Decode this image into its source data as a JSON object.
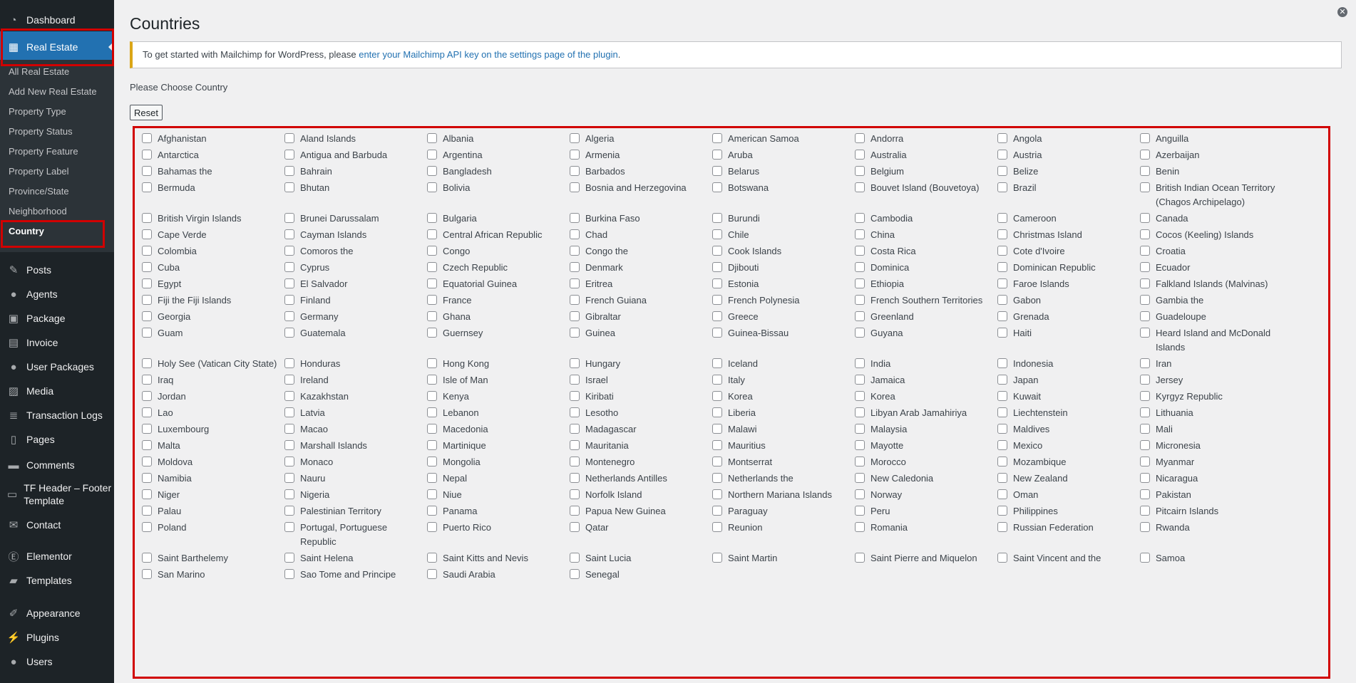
{
  "sidebar": {
    "top_items": [
      {
        "label": "Dashboard",
        "icon": "dashboard-icon"
      },
      {
        "label": "Real Estate",
        "icon": "building-icon"
      }
    ],
    "submenu": [
      "All Real Estate",
      "Add New Real Estate",
      "Property Type",
      "Property Status",
      "Property Feature",
      "Property Label",
      "Province/State",
      "Neighborhood",
      "Country"
    ],
    "bottom_items": [
      {
        "label": "Posts",
        "icon": "pin-icon"
      },
      {
        "label": "Agents",
        "icon": "user-icon"
      },
      {
        "label": "Package",
        "icon": "package-icon"
      },
      {
        "label": "Invoice",
        "icon": "invoice-icon"
      },
      {
        "label": "User Packages",
        "icon": "users-icon"
      },
      {
        "label": "Media",
        "icon": "media-icon"
      },
      {
        "label": "Transaction Logs",
        "icon": "list-icon"
      },
      {
        "label": "Pages",
        "icon": "pages-icon"
      },
      {
        "label": "Comments",
        "icon": "comments-icon"
      },
      {
        "label": "TF Header – Footer Template",
        "icon": "template-icon"
      },
      {
        "label": "Contact",
        "icon": "mail-icon"
      },
      {
        "label": "Elementor",
        "icon": "elementor-icon"
      },
      {
        "label": "Templates",
        "icon": "folder-icon"
      },
      {
        "label": "Appearance",
        "icon": "brush-icon"
      },
      {
        "label": "Plugins",
        "icon": "plugin-icon"
      },
      {
        "label": "Users",
        "icon": "user-icon"
      }
    ]
  },
  "page": {
    "title": "Countries",
    "notice_text": "To get started with Mailchimp for WordPress, please ",
    "notice_link": "enter your Mailchimp API key on the settings page of the plugin",
    "notice_end": ".",
    "choose_label": "Please Choose Country",
    "reset_label": "Reset"
  },
  "colors": {
    "sidebar_bg": "#1d2327",
    "active_bg": "#2271b1",
    "highlight_red": "#d10000",
    "notice_border": "#dba617",
    "link": "#2271b1"
  },
  "countries": [
    "Afghanistan",
    "Aland Islands",
    "Albania",
    "Algeria",
    "American Samoa",
    "Andorra",
    "Angola",
    "Anguilla",
    "Antarctica",
    "Antigua and Barbuda",
    "Argentina",
    "Armenia",
    "Aruba",
    "Australia",
    "Austria",
    "Azerbaijan",
    "Bahamas the",
    "Bahrain",
    "Bangladesh",
    "Barbados",
    "Belarus",
    "Belgium",
    "Belize",
    "Benin",
    "Bermuda",
    "Bhutan",
    "Bolivia",
    "Bosnia and Herzegovina",
    "Botswana",
    "Bouvet Island (Bouvetoya)",
    "Brazil",
    "British Indian Ocean Territory (Chagos Archipelago)",
    "British Virgin Islands",
    "Brunei Darussalam",
    "Bulgaria",
    "Burkina Faso",
    "Burundi",
    "Cambodia",
    "Cameroon",
    "Canada",
    "Cape Verde",
    "Cayman Islands",
    "Central African Republic",
    "Chad",
    "Chile",
    "China",
    "Christmas Island",
    "Cocos (Keeling) Islands",
    "Colombia",
    "Comoros the",
    "Congo",
    "Congo the",
    "Cook Islands",
    "Costa Rica",
    "Cote d'Ivoire",
    "Croatia",
    "Cuba",
    "Cyprus",
    "Czech Republic",
    "Denmark",
    "Djibouti",
    "Dominica",
    "Dominican Republic",
    "Ecuador",
    "Egypt",
    "El Salvador",
    "Equatorial Guinea",
    "Eritrea",
    "Estonia",
    "Ethiopia",
    "Faroe Islands",
    "Falkland Islands (Malvinas)",
    "Fiji the Fiji Islands",
    "Finland",
    "France",
    "French Guiana",
    "French Polynesia",
    "French Southern Territories",
    "Gabon",
    "Gambia the",
    "Georgia",
    "Germany",
    "Ghana",
    "Gibraltar",
    "Greece",
    "Greenland",
    "Grenada",
    "Guadeloupe",
    "Guam",
    "Guatemala",
    "Guernsey",
    "Guinea",
    "Guinea-Bissau",
    "Guyana",
    "Haiti",
    "Heard Island and McDonald Islands",
    "Holy See (Vatican City State)",
    "Honduras",
    "Hong Kong",
    "Hungary",
    "Iceland",
    "India",
    "Indonesia",
    "Iran",
    "Iraq",
    "Ireland",
    "Isle of Man",
    "Israel",
    "Italy",
    "Jamaica",
    "Japan",
    "Jersey",
    "Jordan",
    "Kazakhstan",
    "Kenya",
    "Kiribati",
    "Korea",
    "Korea",
    "Kuwait",
    "Kyrgyz Republic",
    "Lao",
    "Latvia",
    "Lebanon",
    "Lesotho",
    "Liberia",
    "Libyan Arab Jamahiriya",
    "Liechtenstein",
    "Lithuania",
    "Luxembourg",
    "Macao",
    "Macedonia",
    "Madagascar",
    "Malawi",
    "Malaysia",
    "Maldives",
    "Mali",
    "Malta",
    "Marshall Islands",
    "Martinique",
    "Mauritania",
    "Mauritius",
    "Mayotte",
    "Mexico",
    "Micronesia",
    "Moldova",
    "Monaco",
    "Mongolia",
    "Montenegro",
    "Montserrat",
    "Morocco",
    "Mozambique",
    "Myanmar",
    "Namibia",
    "Nauru",
    "Nepal",
    "Netherlands Antilles",
    "Netherlands the",
    "New Caledonia",
    "New Zealand",
    "Nicaragua",
    "Niger",
    "Nigeria",
    "Niue",
    "Norfolk Island",
    "Northern Mariana Islands",
    "Norway",
    "Oman",
    "Pakistan",
    "Palau",
    "Palestinian Territory",
    "Panama",
    "Papua New Guinea",
    "Paraguay",
    "Peru",
    "Philippines",
    "Pitcairn Islands",
    "Poland",
    "Portugal, Portuguese Republic",
    "Puerto Rico",
    "Qatar",
    "Reunion",
    "Romania",
    "Russian Federation",
    "Rwanda",
    "Saint Barthelemy",
    "Saint Helena",
    "Saint Kitts and Nevis",
    "Saint Lucia",
    "Saint Martin",
    "Saint Pierre and Miquelon",
    "Saint Vincent and the",
    "Samoa",
    "San Marino",
    "Sao Tome and Principe",
    "Saudi Arabia",
    "Senegal"
  ]
}
